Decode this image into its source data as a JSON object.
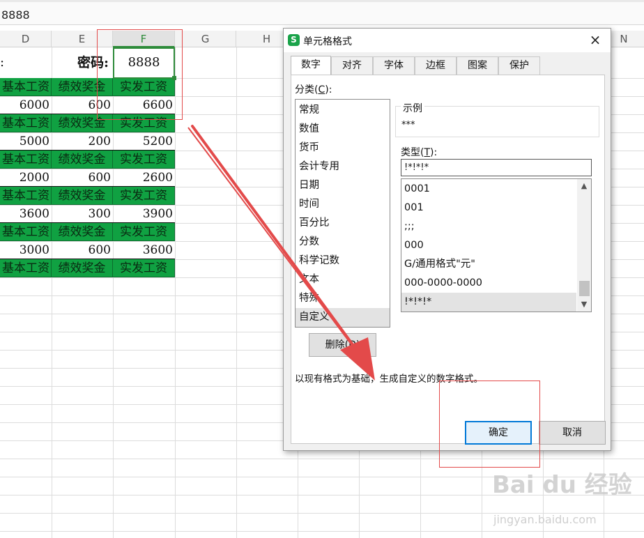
{
  "formula_bar": {
    "value": "8888"
  },
  "columns": [
    "D",
    "E",
    "F",
    "G",
    "H",
    "N"
  ],
  "sheet": {
    "password_label": "密码:",
    "password_value": "8888",
    "header": [
      "基本工资",
      "绩效奖金",
      "实发工资"
    ],
    "rows": [
      [
        "6000",
        "600",
        "6600"
      ],
      [
        "5000",
        "200",
        "5200"
      ],
      [
        "2000",
        "600",
        "2600"
      ],
      [
        "3600",
        "300",
        "3900"
      ],
      [
        "3000",
        "600",
        "3600"
      ]
    ]
  },
  "dialog": {
    "title": "单元格格式",
    "close": "×",
    "tabs": [
      "数字",
      "对齐",
      "字体",
      "边框",
      "图案",
      "保护"
    ],
    "category_label": "分类(",
    "category_key": "C",
    "category_label_end": "):",
    "categories": [
      "常规",
      "数值",
      "货币",
      "会计专用",
      "日期",
      "时间",
      "百分比",
      "分数",
      "科学记数",
      "文本",
      "特殊",
      "自定义"
    ],
    "selected_category": "自定义",
    "sample_title": "示例",
    "sample_value": "***",
    "type_label": "类型(",
    "type_key": "T",
    "type_label_end": "):",
    "type_value": "!*!*!*",
    "formats": [
      "0001",
      "001",
      ";;;",
      "000",
      "G/通用格式\"元\"",
      "000-0000-0000",
      "!*!*!*"
    ],
    "selected_format": "!*!*!*",
    "delete_label": "删除(",
    "delete_key": "D",
    "delete_label_end": ")",
    "description": "以现有格式为基础，生成自定义的数字格式。",
    "ok_label": "确定",
    "cancel_label": "取消"
  },
  "watermark": {
    "brand": "Bai du 经验",
    "url": "jingyan.baidu.com"
  },
  "colors": {
    "header_green": "#10a142",
    "selection_green": "#2e8b3a",
    "annotation_red": "#e34a4a",
    "focus_blue": "#0078d7"
  }
}
